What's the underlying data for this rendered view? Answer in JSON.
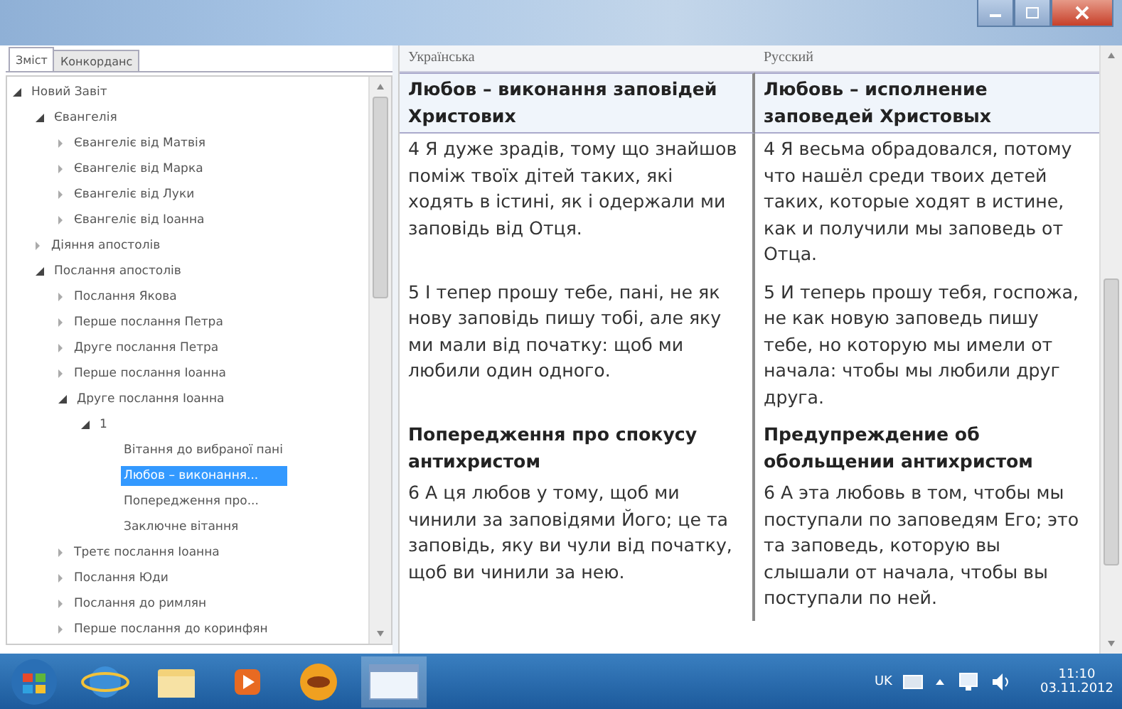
{
  "tabs": [
    {
      "label": "Зміст",
      "selected": true
    },
    {
      "label": "Конкорданс",
      "selected": false
    }
  ],
  "tree": [
    {
      "label": "Новий Завіт",
      "expanded": true,
      "selected": false,
      "children": [
        {
          "label": "Євангелія",
          "expanded": true,
          "selected": false,
          "children": [
            {
              "label": "Євангеліє від Матвія",
              "expanded": false,
              "selected": false
            },
            {
              "label": "Євангеліє від Марка",
              "expanded": false,
              "selected": false
            },
            {
              "label": "Євангеліє від Луки",
              "expanded": false,
              "selected": false
            },
            {
              "label": "Євангеліє від Іоанна",
              "expanded": false,
              "selected": false
            }
          ]
        },
        {
          "label": "Діяння апостолів",
          "expanded": false,
          "selected": false
        },
        {
          "label": "Послання апостолів",
          "expanded": true,
          "selected": false,
          "children": [
            {
              "label": "Послання Якова",
              "expanded": false,
              "selected": false
            },
            {
              "label": "Перше послання Петра",
              "expanded": false,
              "selected": false
            },
            {
              "label": "Друге послання Петра",
              "expanded": false,
              "selected": false
            },
            {
              "label": "Перше послання Іоанна",
              "expanded": false,
              "selected": false
            },
            {
              "label": "Друге послання Іоанна",
              "expanded": true,
              "selected": false,
              "children": [
                {
                  "label": "1",
                  "expanded": true,
                  "selected": false,
                  "children": [
                    {
                      "label": "Вітання до вибраної пані",
                      "kind": "leaf",
                      "selected": false
                    },
                    {
                      "label": "Любов – виконання...",
                      "kind": "leaf",
                      "selected": true
                    },
                    {
                      "label": "Попередження про...",
                      "kind": "leaf",
                      "selected": false
                    },
                    {
                      "label": "Заключне вітання",
                      "kind": "leaf",
                      "selected": false
                    }
                  ]
                }
              ]
            },
            {
              "label": "Третє послання Іоанна",
              "expanded": false,
              "selected": false
            },
            {
              "label": "Послання Юди",
              "expanded": false,
              "selected": false
            },
            {
              "label": "Послання до римлян",
              "expanded": false,
              "selected": false
            },
            {
              "label": "Перше послання до коринфян",
              "expanded": false,
              "selected": false
            }
          ]
        }
      ]
    }
  ],
  "columns": [
    "Українська",
    "Русский"
  ],
  "rows": [
    {
      "kind": "heading",
      "selected": true,
      "cells": [
        "Любов – виконання заповідей Христових",
        "Любовь – исполнение заповедей Христовых"
      ]
    },
    {
      "kind": "verse",
      "selected": false,
      "cells": [
        "4 Я дуже зрадів, тому що знайшов поміж твоїх дітей таких, які ходять в істині, як і одержали ми заповідь від Отця.",
        "4 Я весьма обрадовался, потому что нашёл среди твоих детей таких, которые ходят в истине, как и получили мы заповедь от Отца."
      ]
    },
    {
      "kind": "verse",
      "selected": false,
      "cells": [
        "5 І тепер прошу тебе, пані, не як нову заповідь пишу тобі, але яку ми мали від початку: щоб ми любили один одного.",
        "5 И теперь прошу тебя, госпожа, не как новую заповедь пишу тебе, но которую мы имели от начала: чтобы мы любили друг друга."
      ]
    },
    {
      "kind": "heading",
      "selected": false,
      "cells": [
        "Попередження про спокусу антихристом",
        "Предупреждение об обольщении антихристом"
      ]
    },
    {
      "kind": "verse",
      "selected": false,
      "cells": [
        "6 А ця любов у тому, щоб ми чинили за заповідями Його; це та заповідь, яку ви чули від початку, щоб ви чинили за нею.",
        "6 А эта любовь в том, чтобы мы поступали по заповедям Его; это та заповедь, которую вы слышали от начала, чтобы вы поступали по ней."
      ]
    }
  ],
  "taskbar": {
    "language": "UK",
    "time": "11:10",
    "date": "03.11.2012"
  }
}
